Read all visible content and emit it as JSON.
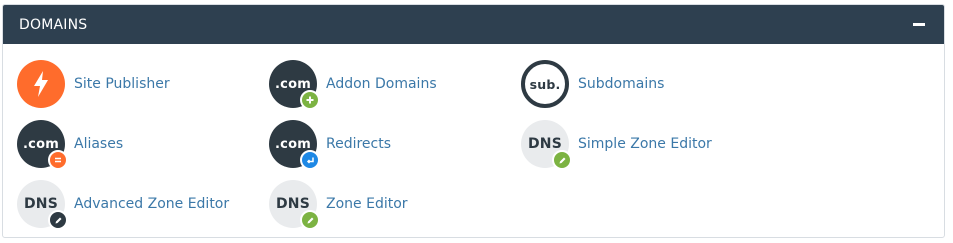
{
  "panel": {
    "title": "DOMAINS",
    "collapse_icon": "minus-icon"
  },
  "colors": {
    "header_bg": "#2e4050",
    "link": "#3b78a8",
    "dark_icon": "#2e3a43",
    "light_icon": "#e9ebed",
    "orange": "#ff6c2c",
    "green_badge": "#7cb342",
    "blue_badge": "#1e88e5"
  },
  "items": [
    {
      "label": "Site Publisher",
      "icon_text": "",
      "icon": "lightning-bolt-icon"
    },
    {
      "label": "Addon Domains",
      "icon_text": ".com",
      "icon": "com-plus-icon"
    },
    {
      "label": "Subdomains",
      "icon_text": "sub.",
      "icon": "sub-icon"
    },
    {
      "label": "Aliases",
      "icon_text": ".com",
      "icon": "com-equals-icon"
    },
    {
      "label": "Redirects",
      "icon_text": ".com",
      "icon": "com-redirect-icon"
    },
    {
      "label": "Simple Zone Editor",
      "icon_text": "DNS",
      "icon": "dns-pencil-icon"
    },
    {
      "label": "Advanced Zone Editor",
      "icon_text": "DNS",
      "icon": "dns-pencil-dark-icon"
    },
    {
      "label": "Zone Editor",
      "icon_text": "DNS",
      "icon": "dns-pencil-green-icon"
    }
  ]
}
